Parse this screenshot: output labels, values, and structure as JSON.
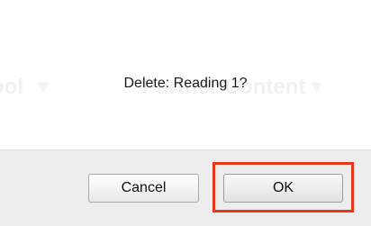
{
  "background": {
    "left_text": "ool",
    "right_text": "Partner Content",
    "chevron": "▾"
  },
  "dialog": {
    "message": "Delete: Reading 1?",
    "cancel_label": "Cancel",
    "ok_label": "OK"
  },
  "colors": {
    "highlight": "#e5361b",
    "footer_bg": "#ededed"
  }
}
